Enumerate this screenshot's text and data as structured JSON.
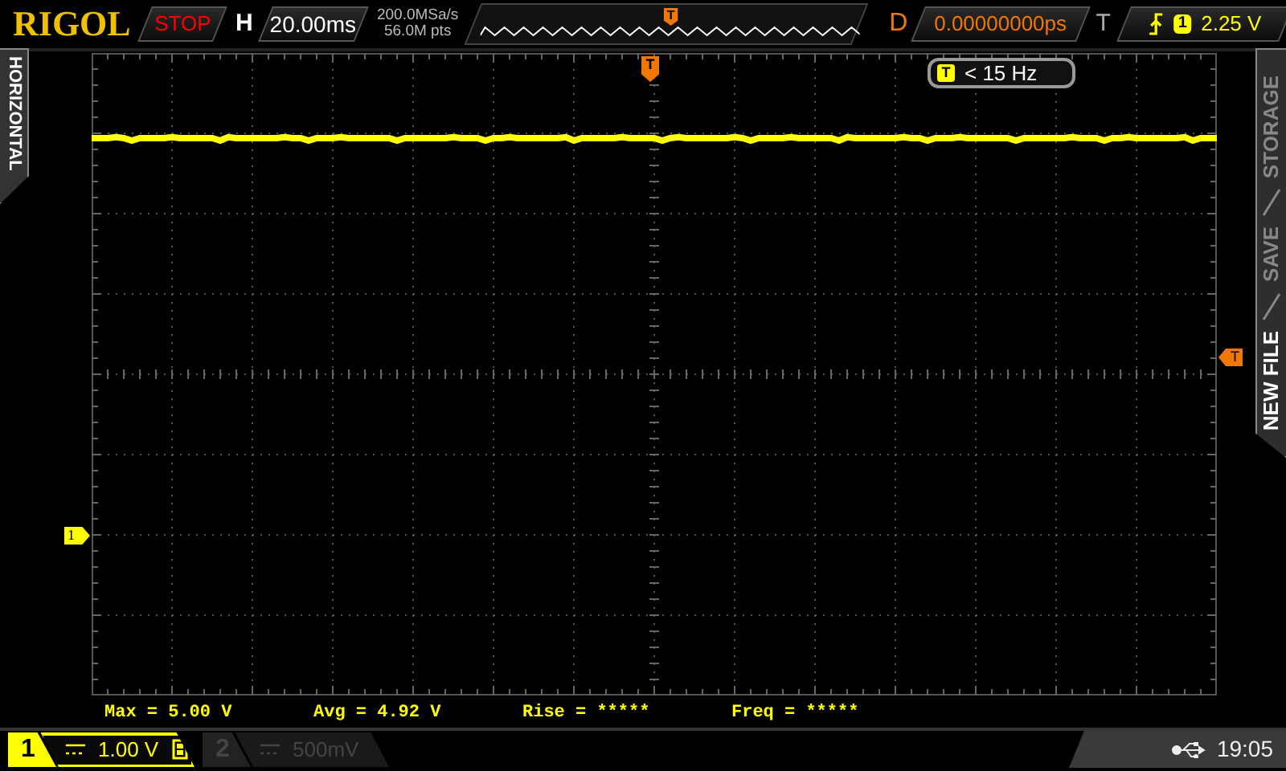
{
  "brand": "RIGOL",
  "run_state": "STOP",
  "timebase": {
    "label": "H",
    "value": "20.00ms"
  },
  "acquisition": {
    "sample_rate": "200.0MSa/s",
    "memory_depth": "56.0M pts"
  },
  "overview_marker": "T",
  "delay": {
    "label": "D",
    "value": "0.00000000ps"
  },
  "trigger": {
    "label": "T",
    "source": "1",
    "level": "2.25 V"
  },
  "left_menu": {
    "title": "HORIZONTAL"
  },
  "right_menu": [
    {
      "label": "STORAGE",
      "selected": false
    },
    {
      "label": "SAVE",
      "selected": false
    },
    {
      "label": "NEW FILE",
      "selected": true
    }
  ],
  "trigger_position_marker": "T",
  "frequency_badge": {
    "source": "T",
    "text": "< 15 Hz"
  },
  "trigger_level_marker": "T",
  "channel_marker": "1",
  "measurements": [
    "Max = 5.00 V",
    "Avg = 4.92 V",
    "Rise = *****",
    "Freq = *****"
  ],
  "channels": [
    {
      "number": "1",
      "scale": "1.00 V",
      "on": true
    },
    {
      "number": "2",
      "scale": "500mV",
      "on": false
    }
  ],
  "status": {
    "time": "19:05"
  }
}
